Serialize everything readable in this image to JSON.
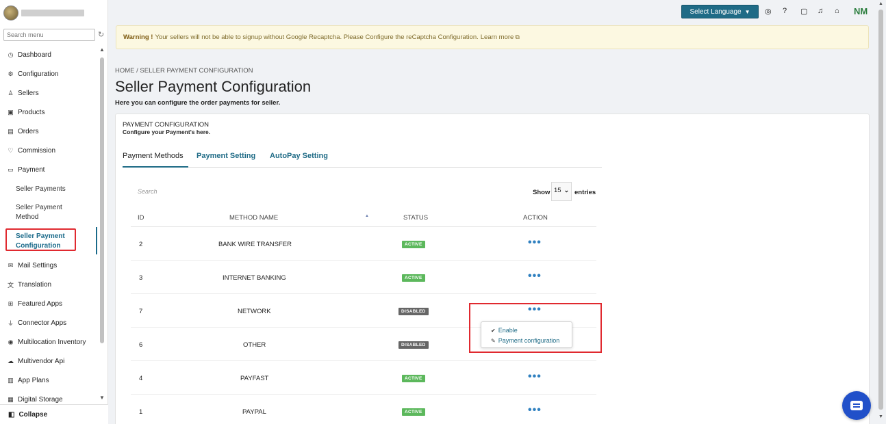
{
  "sidebar": {
    "search_placeholder": "Search menu",
    "items": [
      {
        "label": "Dashboard",
        "icon": "dashboard-icon"
      },
      {
        "label": "Configuration",
        "icon": "gear-icon"
      },
      {
        "label": "Sellers",
        "icon": "user-icon"
      },
      {
        "label": "Products",
        "icon": "product-icon"
      },
      {
        "label": "Orders",
        "icon": "orders-icon"
      },
      {
        "label": "Commission",
        "icon": "handshake-icon"
      },
      {
        "label": "Payment",
        "icon": "payment-icon"
      }
    ],
    "sub_items": [
      {
        "label": "Seller Payments"
      },
      {
        "label": "Seller Payment Method"
      },
      {
        "label": "Seller Payment Configuration"
      }
    ],
    "items_after": [
      {
        "label": "Mail Settings",
        "icon": "mail-icon"
      },
      {
        "label": "Translation",
        "icon": "translate-icon"
      },
      {
        "label": "Featured Apps",
        "icon": "apps-icon"
      },
      {
        "label": "Connector Apps",
        "icon": "connector-icon"
      },
      {
        "label": "Multilocation Inventory",
        "icon": "location-icon"
      },
      {
        "label": "Multivendor Api",
        "icon": "cloud-icon"
      },
      {
        "label": "App Plans",
        "icon": "clipboard-icon"
      },
      {
        "label": "Digital Storage",
        "icon": "storage-icon"
      }
    ],
    "collapse_label": "Collapse"
  },
  "topbar": {
    "language_label": "Select Language",
    "user_initials": "NM"
  },
  "warning": {
    "strong": "Warning !",
    "text": "Your sellers will not be able to signup without Google Recaptcha. Please Configure the reCaptcha Configuration.",
    "link": "Learn more"
  },
  "header": {
    "breadcrumb": "HOME / SELLER PAYMENT CONFIGURATION",
    "title": "Seller Payment Configuration",
    "subtitle": "Here you can configure the order payments for seller."
  },
  "card": {
    "title": "PAYMENT CONFIGURATION",
    "subtitle": "Configure your Payment's here.",
    "tabs": [
      "Payment Methods",
      "Payment Setting",
      "AutoPay Setting"
    ],
    "search_placeholder": "Search",
    "show_label": "Show",
    "show_value": "15",
    "entries_label": "entries"
  },
  "table": {
    "headers": [
      "ID",
      "METHOD NAME",
      "STATUS",
      "ACTION"
    ],
    "rows": [
      {
        "id": "2",
        "name": "BANK WIRE TRANSFER",
        "status": "ACTIVE"
      },
      {
        "id": "3",
        "name": "INTERNET BANKING",
        "status": "ACTIVE"
      },
      {
        "id": "7",
        "name": "NETWORK",
        "status": "DISABLED"
      },
      {
        "id": "6",
        "name": "OTHER",
        "status": "DISABLED"
      },
      {
        "id": "4",
        "name": "PAYFAST",
        "status": "ACTIVE"
      },
      {
        "id": "1",
        "name": "PAYPAL",
        "status": "ACTIVE"
      }
    ],
    "action_dots": "•••"
  },
  "dropdown": {
    "items": [
      "Enable",
      "Payment configuration"
    ]
  },
  "colors": {
    "accent": "#1f6b86",
    "active_badge": "#5cb85c",
    "disabled_badge": "#666666",
    "highlight": "#e0292f",
    "chat": "#2150c9"
  }
}
